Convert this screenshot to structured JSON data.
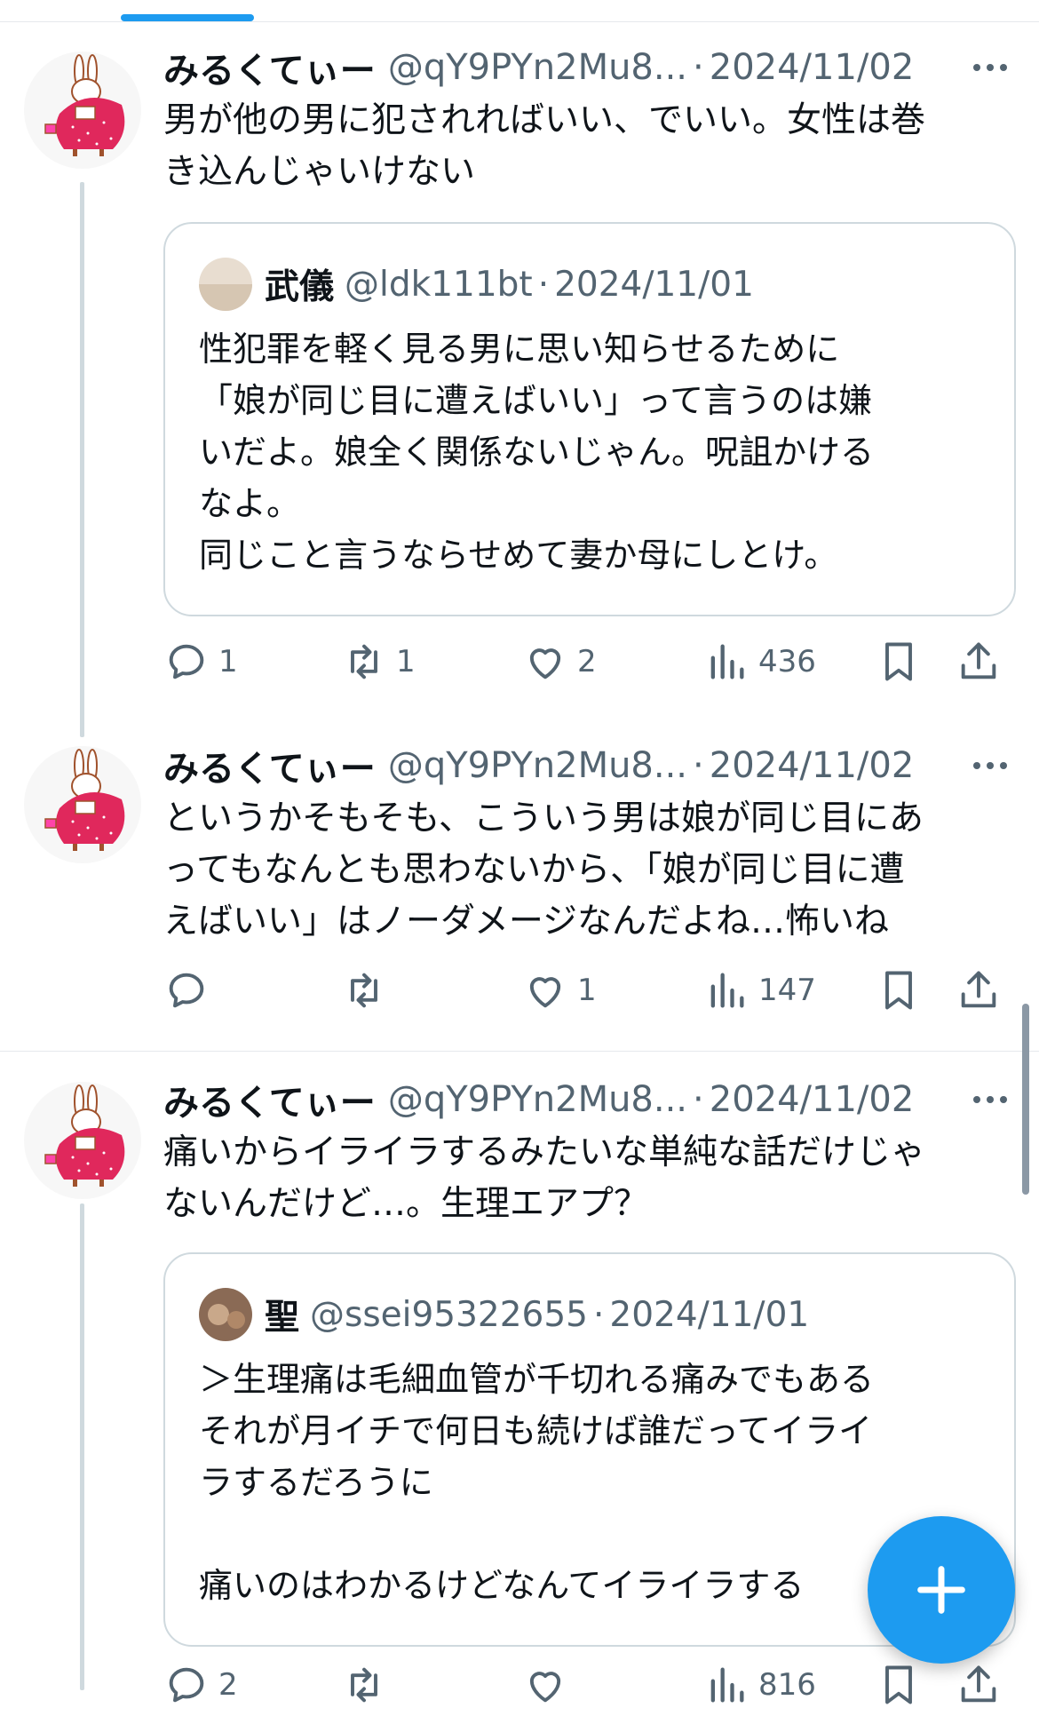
{
  "tweets": [
    {
      "name": "みるくてぃー",
      "handle": "@qY9PYn2Mu8...",
      "date": "2024/11/02",
      "text": "男が他の男に犯されればいい、でいい。女性は巻\nき込んじゃいけない",
      "quote": {
        "name": "武儀",
        "handle": "@ldk111bt",
        "date": "2024/11/01",
        "text": "性犯罪を軽く見る男に思い知らせるために\n「娘が同じ目に遭えばいい」って言うのは嫌\nいだよ。娘全く関係ないじゃん。呪詛かける\nなよ。\n同じこと言うならせめて妻か母にしとけ。"
      },
      "stats": {
        "replies": "1",
        "retweets": "1",
        "likes": "2",
        "views": "436"
      }
    },
    {
      "name": "みるくてぃー",
      "handle": "@qY9PYn2Mu8...",
      "date": "2024/11/02",
      "text": "というかそもそも、こういう男は娘が同じ目にあ\nってもなんとも思わないから、「娘が同じ目に遭\nえばいい」はノーダメージなんだよね…怖いね",
      "stats": {
        "replies": "",
        "retweets": "",
        "likes": "1",
        "views": "147"
      }
    },
    {
      "name": "みるくてぃー",
      "handle": "@qY9PYn2Mu8...",
      "date": "2024/11/02",
      "text": "痛いからイライラするみたいな単純な話だけじゃ\nないんだけど…。生理エアプ？",
      "quote": {
        "name": "聖",
        "handle": "@ssei95322655",
        "date": "2024/11/01",
        "text": "＞生理痛は毛細血管が千切れる痛みでもある\nそれが月イチで何日も続けば誰だってイライ\nラするだろうに\n\n痛いのはわかるけどなんてイライラする"
      },
      "stats": {
        "replies": "2",
        "retweets": "",
        "likes": "",
        "views": "816"
      }
    }
  ],
  "separator_dot": "·",
  "colors": {
    "accent": "#1d9bf0",
    "secondary_text": "#536471",
    "border": "#cfd9de",
    "avatar_dress": "#e0285c"
  },
  "icons": [
    "reply-icon",
    "retweet-icon",
    "like-icon",
    "views-icon",
    "bookmark-icon",
    "share-icon",
    "more-icon",
    "compose-plus-icon"
  ]
}
